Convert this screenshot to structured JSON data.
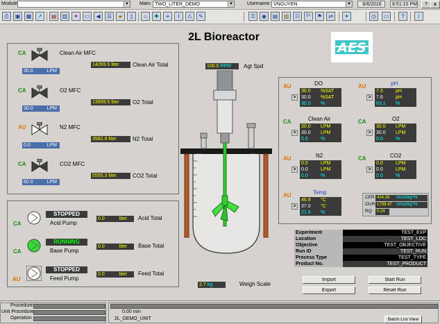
{
  "topbar": {
    "module_label": "Module:",
    "module_value": "",
    "main_label": "Main:",
    "main_value": "TWO_LITER_DEMO",
    "username_label": "Username:",
    "username_value": "VNGUYEN",
    "date": "6/6/2016",
    "time": "8:51:10 PM",
    "help_btn": "?",
    "close_btn": "x"
  },
  "title": "2L Bioreactor",
  "logo_text": "AES",
  "gas": [
    {
      "mode": "CA",
      "name": "Clean Air MFC",
      "flow": "30.0",
      "unit": "LPM",
      "total": "14269.5 liter",
      "total_label": "Clean Air Total",
      "valve_color": "#404040"
    },
    {
      "mode": "CA",
      "name": "O2 MFC",
      "flow": "30.0",
      "unit": "LPM",
      "total": "13699.5 liter",
      "total_label": "O2 Total",
      "valve_color": "#404040"
    },
    {
      "mode": "AU",
      "name": "N2 MFC",
      "flow": "0.0",
      "unit": "LPM",
      "total": "3582.8 liter",
      "total_label": "N2 Total",
      "valve_color": "#ffffff"
    },
    {
      "mode": "CA",
      "name": "CO2 MFC",
      "flow": "60.0",
      "unit": "LPM",
      "total": "5555.3 liter",
      "total_label": "CO2 Total",
      "valve_color": "#404040"
    }
  ],
  "pumps": [
    {
      "mode": "CA",
      "status": "STOPPED",
      "status_color": "#ffffff",
      "name": "Acid Pump",
      "total": "0.0",
      "unit": "liter",
      "total_label": "Acid Total",
      "pump_color": "#ffffff"
    },
    {
      "mode": "CA",
      "status": "RUNNING",
      "status_color": "#00ff00",
      "name": "Base Pump",
      "total": "0.0",
      "unit": "liter",
      "total_label": "Base Total",
      "pump_color": "#33dd33"
    },
    {
      "mode": "AU",
      "status": "STOPPED",
      "status_color": "#ffffff",
      "name": "Feed Pump",
      "total": "0.0",
      "unit": "liter",
      "total_label": "Feed Total",
      "pump_color": "#ffffff"
    }
  ],
  "agitation": {
    "value": "100.0",
    "unit": "RPM",
    "label": "Agt Spd"
  },
  "weigh": {
    "value": "2.7",
    "unit": "kg",
    "label": "Weigh Scale"
  },
  "loops": {
    "do": {
      "mode": "AU",
      "title": "DO",
      "rows": [
        [
          "30.0",
          "%SAT"
        ],
        [
          "30.0",
          "%SAT"
        ],
        [
          "30.0",
          "%"
        ]
      ]
    },
    "ph": {
      "mode": "AU",
      "title": "pH",
      "rows": [
        [
          "7.3",
          "pH"
        ],
        [
          "7.6",
          "pH"
        ],
        [
          "63.1",
          "%"
        ]
      ]
    },
    "cleanair": {
      "mode": "CA",
      "title": "Clean Air",
      "rows": [
        [
          "30.0",
          "LPM"
        ],
        [
          "30.0",
          "LPM"
        ],
        [
          "0.0",
          "%"
        ]
      ]
    },
    "o2": {
      "mode": "CA",
      "title": "O2",
      "rows": [
        [
          "30.0",
          "LPM"
        ],
        [
          "30.0",
          "LPM"
        ],
        [
          "0.0",
          "%"
        ]
      ]
    },
    "n2": {
      "mode": "AU",
      "title": "N2",
      "rows": [
        [
          "0.0",
          "LPM"
        ],
        [
          "0.0",
          "LPM"
        ],
        [
          "0.0",
          "%"
        ]
      ]
    },
    "co2": {
      "mode": "CA",
      "title": "CO2",
      "rows": [
        [
          "0.0",
          "LPM"
        ],
        [
          "0.0",
          "LPM"
        ],
        [
          "0.0",
          "%"
        ]
      ]
    },
    "temp": {
      "mode": "AU",
      "title": "Temp",
      "rows": [
        [
          "46.9",
          "°C"
        ],
        [
          "37.0",
          "°C"
        ],
        [
          "21.6",
          "%"
        ]
      ]
    }
  },
  "rates": [
    {
      "label": "CER",
      "value": "414.16",
      "unit": "mmol/kg^hr"
    },
    {
      "label": "OUR",
      "value": "1739.47",
      "unit": "mmol/kg^hr"
    },
    {
      "label": "RQ",
      "value": "0.24",
      "unit": ""
    }
  ],
  "info": [
    {
      "label": "Experiment",
      "value": "TEST_EXP"
    },
    {
      "label": "Location",
      "value": "TEST_LOC"
    },
    {
      "label": "Objective",
      "value": "TEST_OBJECTIVE"
    },
    {
      "label": "Run ID",
      "value": "TEST_RUN"
    },
    {
      "label": "Process Type",
      "value": "TEST_TYPE"
    },
    {
      "label": "Product No.",
      "value": "TEST_PRODUCT"
    }
  ],
  "buttons": {
    "import": "Import",
    "export": "Export",
    "start_run": "Start Run",
    "reset_run": "Reset Run",
    "batch_list": "Batch List View"
  },
  "bottom": {
    "procedure_label": "Procedure",
    "unit_procedure_label": "Unit Procedure",
    "operation_label": "Operation",
    "time": "0.00 min",
    "unit": "2L_DEMO_UNIT"
  },
  "colors": {
    "ca": "#1a8a1a",
    "au": "#e07000",
    "value_bg": "#3a3a3a",
    "value_yellow": "#ffff00",
    "value_cyan": "#00ffff"
  }
}
